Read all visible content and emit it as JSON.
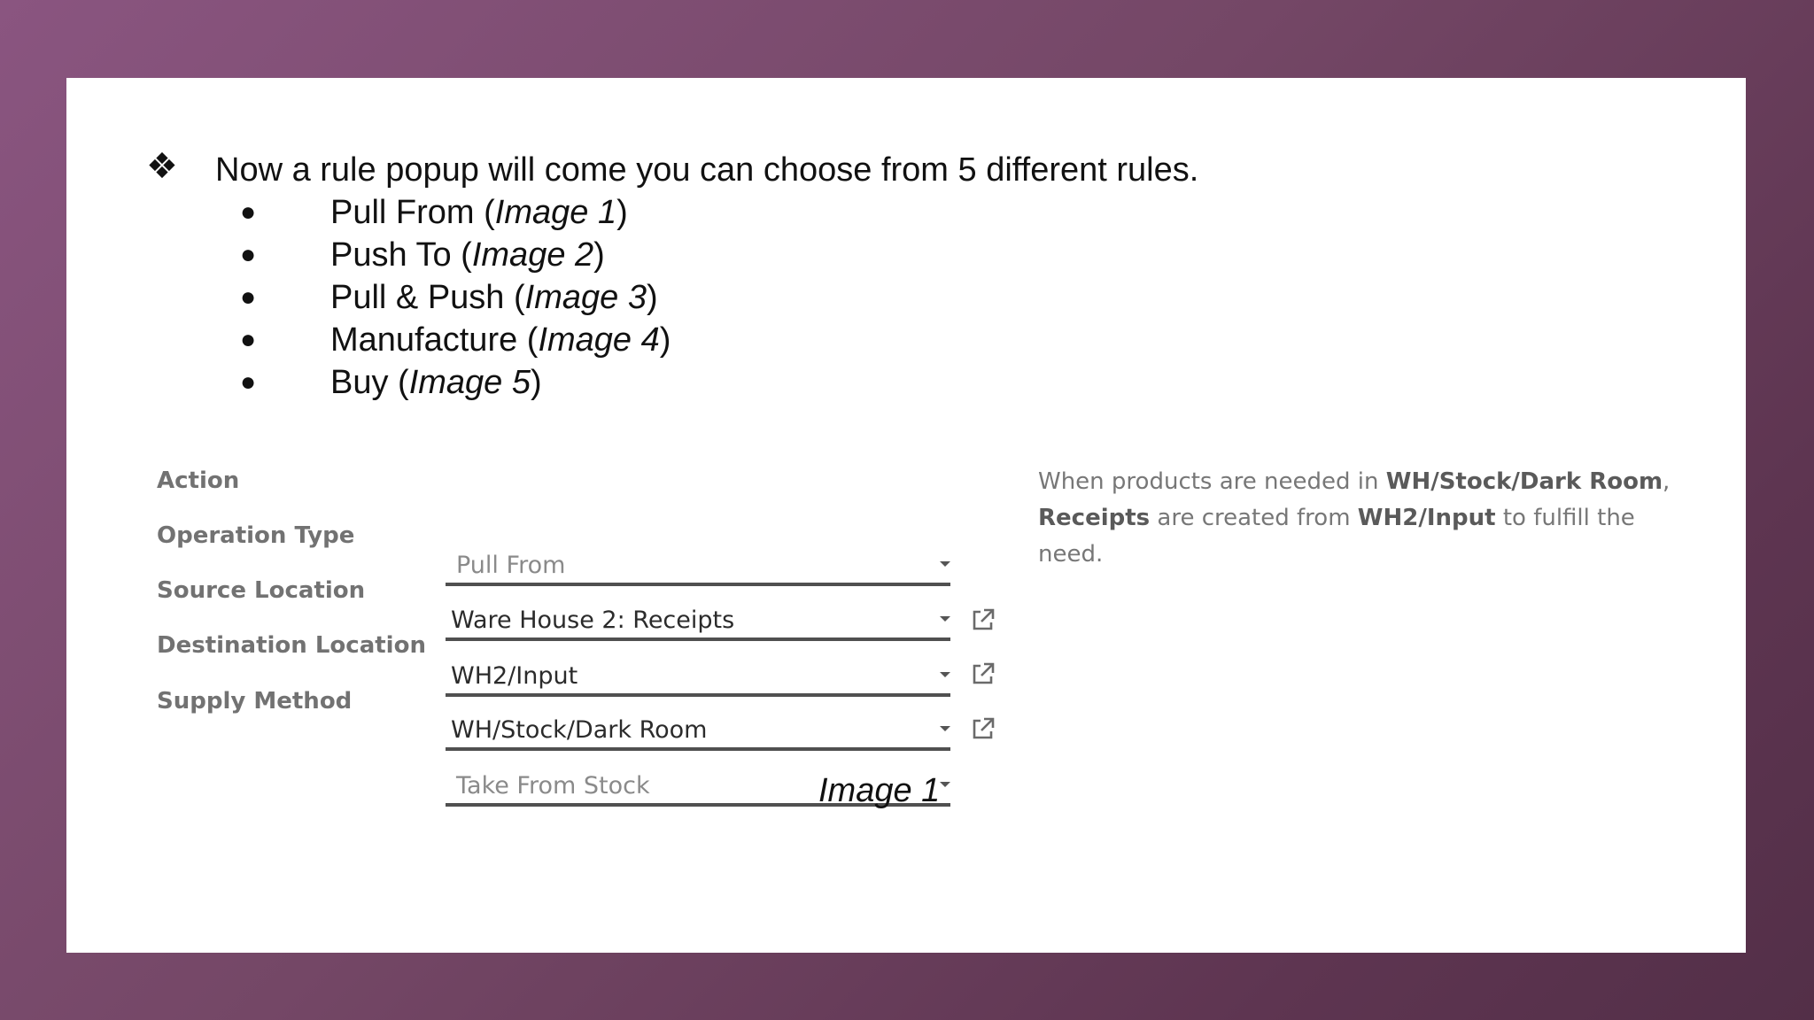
{
  "main_point": {
    "bullet_icon": "four-diamond-bullet-icon",
    "text": "Now a rule popup will come you can choose from 5 different rules."
  },
  "rules": [
    {
      "name": "Pull From",
      "ref": "Image 1"
    },
    {
      "name": "Push To",
      "ref": "Image 2"
    },
    {
      "name": "Pull & Push",
      "ref": "Image 3"
    },
    {
      "name": "Manufacture",
      "ref": "Image 4"
    },
    {
      "name": "Buy",
      "ref": "Image 5"
    }
  ],
  "form": {
    "action": {
      "label": "Action",
      "value": "Pull From"
    },
    "operation_type": {
      "label": "Operation Type",
      "value": "Ware House 2: Receipts"
    },
    "source_location": {
      "label": "Source Location",
      "value": "WH2/Input"
    },
    "destination_location": {
      "label": "Destination Location",
      "value": "WH/Stock/Dark Room"
    },
    "supply_method": {
      "label": "Supply Method",
      "value": "Take From Stock"
    }
  },
  "help": {
    "part1": "When products are needed in ",
    "bold1": "WH/Stock/Dark Room",
    "part2": ", ",
    "bold2": "Receipts",
    "part3": " are created from ",
    "bold3": "WH2/Input",
    "part4": " to fulfill the need."
  },
  "caption": "Image 1"
}
